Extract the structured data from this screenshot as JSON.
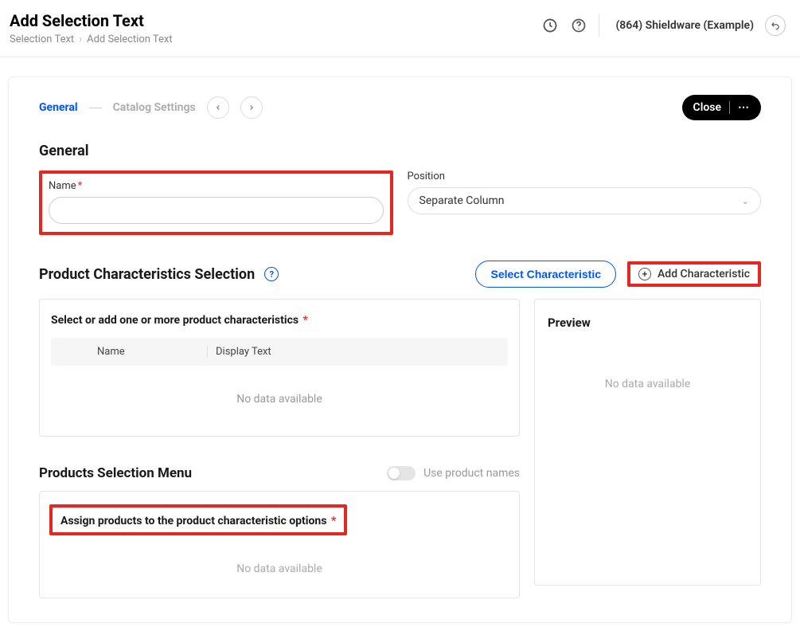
{
  "header": {
    "title": "Add Selection Text",
    "breadcrumb": {
      "parent": "Selection Text",
      "current": "Add Selection Text"
    },
    "account": "(864) Shieldware (Example)"
  },
  "tabs": {
    "active": "General",
    "inactive": "Catalog Settings"
  },
  "buttons": {
    "close": "Close",
    "select_characteristic": "Select Characteristic",
    "add_characteristic": "Add Characteristic"
  },
  "sections": {
    "general": "General",
    "product_characteristics": "Product Characteristics Selection",
    "products_selection_menu": "Products Selection Menu",
    "preview": "Preview"
  },
  "fields": {
    "name_label": "Name",
    "position_label": "Position",
    "position_value": "Separate Column"
  },
  "select_panel": {
    "heading": "Select or add one or more product characteristics",
    "col_name": "Name",
    "col_display": "Display Text",
    "no_data": "No data available"
  },
  "preview_panel": {
    "no_data": "No data available"
  },
  "toggle": {
    "label": "Use product names"
  },
  "assign_panel": {
    "heading": "Assign products to the product characteristic options",
    "no_data": "No data available"
  }
}
